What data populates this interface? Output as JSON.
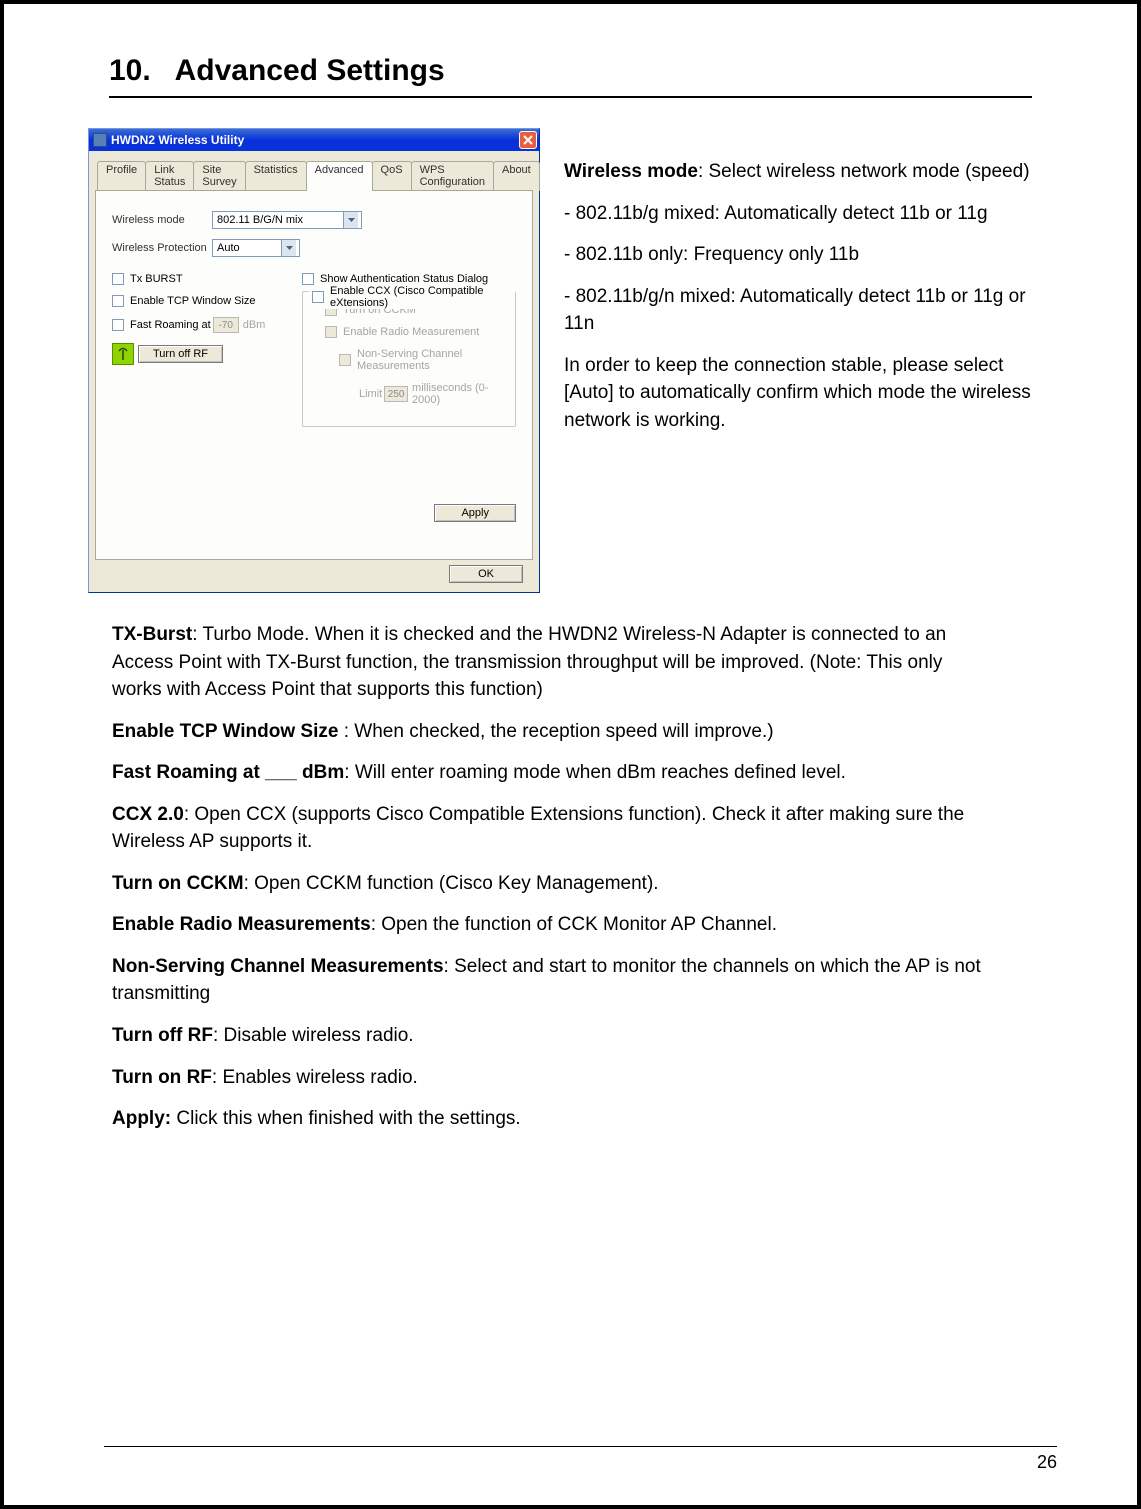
{
  "section_number": "10.",
  "section_title": "Advanced Settings",
  "window": {
    "title": "HWDN2 Wireless Utility",
    "tabs": [
      "Profile",
      "Link Status",
      "Site Survey",
      "Statistics",
      "Advanced",
      "QoS",
      "WPS Configuration",
      "About"
    ],
    "active_tab_index": 4,
    "wireless_mode_label": "Wireless mode",
    "wireless_mode_value": "802.11 B/G/N mix",
    "wireless_protection_label": "Wireless Protection",
    "wireless_protection_value": "Auto",
    "tx_burst_label": "Tx BURST",
    "tcp_window_label": "Enable TCP Window Size",
    "fast_roaming_label": "Fast Roaming at",
    "fast_roaming_value": "-70",
    "fast_roaming_unit": "dBm",
    "turn_off_rf_label": "Turn off RF",
    "show_auth_label": "Show Authentication Status Dialog",
    "enable_ccx_label": "Enable CCX (Cisco Compatible eXtensions)",
    "turn_on_cckm_label": "Turn on CCKM",
    "enable_radio_meas_label": "Enable Radio Measurement",
    "nonserving_label": "Non-Serving Channel Measurements",
    "limit_label": "Limit",
    "limit_value": "250",
    "limit_unit": "milliseconds (0-2000)",
    "apply_label": "Apply",
    "ok_label": "OK"
  },
  "right_prose": {
    "p1_bold": "Wireless mode",
    "p1_rest": ": Select wireless network mode (speed)",
    "p2": "- 802.11b/g mixed: Automatically detect 11b or 11g",
    "p3": "- 802.11b only: Frequency only 11b",
    "p4": "- 802.11b/g/n mixed: Automatically detect 11b or 11g or 11n",
    "p5": "In order to keep the connection stable, please select [Auto] to automatically confirm which mode the wireless network is working."
  },
  "body": {
    "items": [
      {
        "bold": "TX-Burst",
        "rest": ": Turbo Mode.   When it is checked and the HWDN2 Wireless-N Adapter is connected to an Access Point with TX-Burst function,  the transmission throughput will be improved. (Note: This only works with Access Point that supports this function)"
      },
      {
        "bold": "Enable TCP Window Size ",
        "rest": ": When checked, the reception speed will improve.)"
      },
      {
        "bold": "Fast Roaming at ___ dBm",
        "rest": ": Will enter roaming mode when dBm reaches defined level."
      },
      {
        "bold": "CCX 2.0",
        "rest": ": Open CCX (supports Cisco Compatible Extensions function). Check it after making sure the Wireless AP supports it."
      },
      {
        "bold": "Turn on CCKM",
        "rest": ": Open CCKM function (Cisco Key Management)."
      },
      {
        "bold": "Enable Radio Measurements",
        "rest": ": Open the function of CCK Monitor AP Channel."
      },
      {
        "bold": "Non-Serving Channel Measurements",
        "rest": ": Select and start to monitor the channels on which the AP is not transmitting"
      },
      {
        "bold": "Turn off RF",
        "rest": ": Disable wireless radio."
      },
      {
        "bold": "Turn on RF",
        "rest": ": Enables wireless radio."
      },
      {
        "bold": "Apply:",
        "rest": " Click this when finished with the settings."
      }
    ]
  },
  "page_number": "26"
}
